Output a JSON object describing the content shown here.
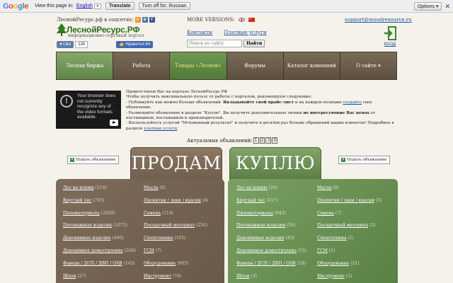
{
  "translate_bar": {
    "logo": [
      "G",
      "o",
      "o",
      "g",
      "l",
      "e"
    ],
    "logo_colors": [
      "#4285f4",
      "#ea4335",
      "#fbbc05",
      "#4285f4",
      "#34a853",
      "#ea4335"
    ],
    "view_text": "View this page in:",
    "language": "English",
    "translate_button": "Translate",
    "turn_off_button": "Turn off for: Russian",
    "options_button": "Options ▾",
    "close": "✕"
  },
  "header": {
    "site_in_social": "ЛеснойРесурс.рф в соцсетях:",
    "logo_name": "ЛеснойРесурс.РФ",
    "logo_sub": "информационно-торговый портал",
    "vk_like": "♥ Like",
    "vk_count": "130",
    "fb_like": "👍 Нравится 64",
    "more_versions": "MORE VERSIONS:",
    "contacts": "Контакты",
    "paid_services": "Платные услуги",
    "search_placeholder": "Поиск по сайту",
    "search_button": "Найти",
    "email": "support@woodresource.ru",
    "login": "ВХОД"
  },
  "nav": [
    {
      "label": "Лесная биржа",
      "style": "green"
    },
    {
      "label": "Работа",
      "style": "brown"
    },
    {
      "label": "Товары «Лесной»",
      "style": "active"
    },
    {
      "label": "Форумы",
      "style": "brown"
    },
    {
      "label": "Каталог компаний",
      "style": "brown"
    },
    {
      "label": "О сайте ▾",
      "style": "brown"
    }
  ],
  "video": {
    "message": "Your browser does not currently recognize any of the video formats available."
  },
  "intro": {
    "line1": "Приветствуем Вас на портале ЛеснойРесурс.РФ",
    "line2": "Чтобы получить максимальную пользу от работы с порталом, рекомендуем следующие:",
    "line3a": "- Публикуйте как можно больше объявлений. ",
    "line3b": "Вкладывайте свой прайс-лист",
    "line3c": " и на каждую позицию ",
    "line3d": "создайте",
    "line3e": " свое объявление.",
    "line4a": "- Размещайте объявление в разделе \"Куплю\". Вы получите дополнительные звонки ",
    "line4b": "не интересующие Вас ценах",
    "line4c": " от поставщиков, поставщиков и производителей.",
    "line5a": "- Воспользуйтесь услугой \"Мгновенный результат\" и получите в десятки раз больше обращений ваших клиентов! Подробнее в разделе ",
    "line5b": "платные услуги"
  },
  "pagination": {
    "label": "Актуальных объявлений:",
    "pages": [
      "1",
      "2",
      "3",
      "9"
    ]
  },
  "sell": {
    "add_button": "Подать объявление",
    "title": "ПРОДАМ",
    "left": [
      {
        "name": "Лес на корню",
        "count": "(214)"
      },
      {
        "name": "Круглый лес",
        "count": "(703)"
      },
      {
        "name": "Пиломатериалы",
        "count": "(2649)"
      },
      {
        "name": "Погонажные изделия",
        "count": "(1072)"
      },
      {
        "name": "Деревянные изделия",
        "count": "(446)"
      },
      {
        "name": "Деревянное домостроение",
        "count": "(200)"
      },
      {
        "name": "Фанера / ДСП / ДВП / OSB",
        "count": "(145)"
      },
      {
        "name": "Шпон",
        "count": "(27)"
      }
    ],
    "right": [
      {
        "name": "Масла",
        "count": "(6)"
      },
      {
        "name": "Пропитки / лаки / краски",
        "count": "(8)"
      },
      {
        "name": "Семена",
        "count": "(114)"
      },
      {
        "name": "Посадочный материал",
        "count": "(256)"
      },
      {
        "name": "Спецтехника",
        "count": "(105)"
      },
      {
        "name": "ГСМ",
        "count": "(7)"
      },
      {
        "name": "Оборудование",
        "count": "(905)"
      },
      {
        "name": "Инструмент",
        "count": "(74)"
      }
    ]
  },
  "buy": {
    "add_button": "Подать объявление",
    "title": "КУПЛЮ",
    "left": [
      {
        "name": "Лес на корню",
        "count": "(24)"
      },
      {
        "name": "Круглый лес",
        "count": "(517)"
      },
      {
        "name": "Пиломатериалы",
        "count": "(843)"
      },
      {
        "name": "Погонажные изделия",
        "count": "(56)"
      },
      {
        "name": "Деревянные изделия",
        "count": "(43)"
      },
      {
        "name": "Деревянное домостроение",
        "count": "(15)"
      },
      {
        "name": "Фанера / ДСП / ДВП / OSB",
        "count": "(18)"
      },
      {
        "name": "Шпон",
        "count": "(3)"
      }
    ],
    "right": [
      {
        "name": "Масла",
        "count": "(0)"
      },
      {
        "name": "Пропитки / лаки / краски",
        "count": "(3)"
      },
      {
        "name": "Семена",
        "count": "(7)"
      },
      {
        "name": "Посадочный материал",
        "count": "(2)"
      },
      {
        "name": "Спецтехника",
        "count": "(1)"
      },
      {
        "name": "ГСМ",
        "count": "(1)"
      },
      {
        "name": "Оборудование",
        "count": "(21)"
      },
      {
        "name": "Инструмент",
        "count": "(2)"
      }
    ]
  }
}
